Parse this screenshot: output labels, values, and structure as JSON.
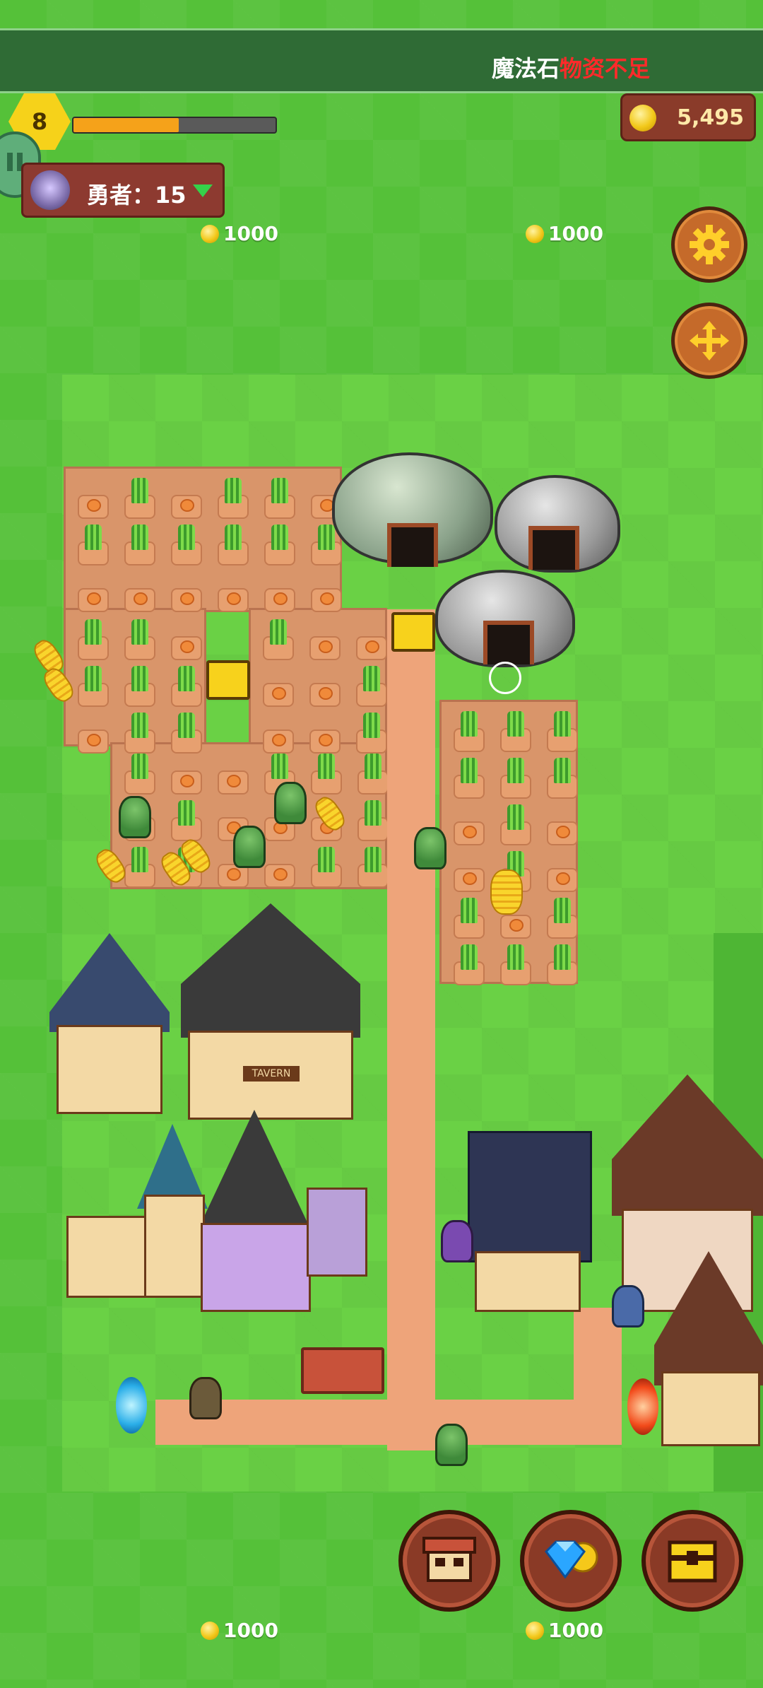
{
  "top_bar": {
    "message_prefix": "魔法石",
    "message_warning": "物资不足"
  },
  "player": {
    "level": "8",
    "xp_progress": 0.52,
    "gold": "5,495"
  },
  "hero": {
    "label": "勇者：15"
  },
  "build_slots": {
    "top_left_price": "1000",
    "top_right_price": "1000",
    "bottom_left_price": "1000",
    "bottom_right_price": "1000"
  },
  "buttons": {
    "settings_icon": "gear-icon",
    "move_icon": "move-arrows-icon",
    "pause_icon": "pause-icon",
    "shop_icon": "shop-stall-icon",
    "gem_shop_icon": "gem-coin-icon",
    "chest_icon": "treasure-chest-icon"
  },
  "map": {
    "tavern_sign": "TAVERN",
    "colors": {
      "grass": "#6ad145",
      "road": "#eea47a",
      "farmland": "#d9956a",
      "warning": "#ff2a2a"
    }
  }
}
